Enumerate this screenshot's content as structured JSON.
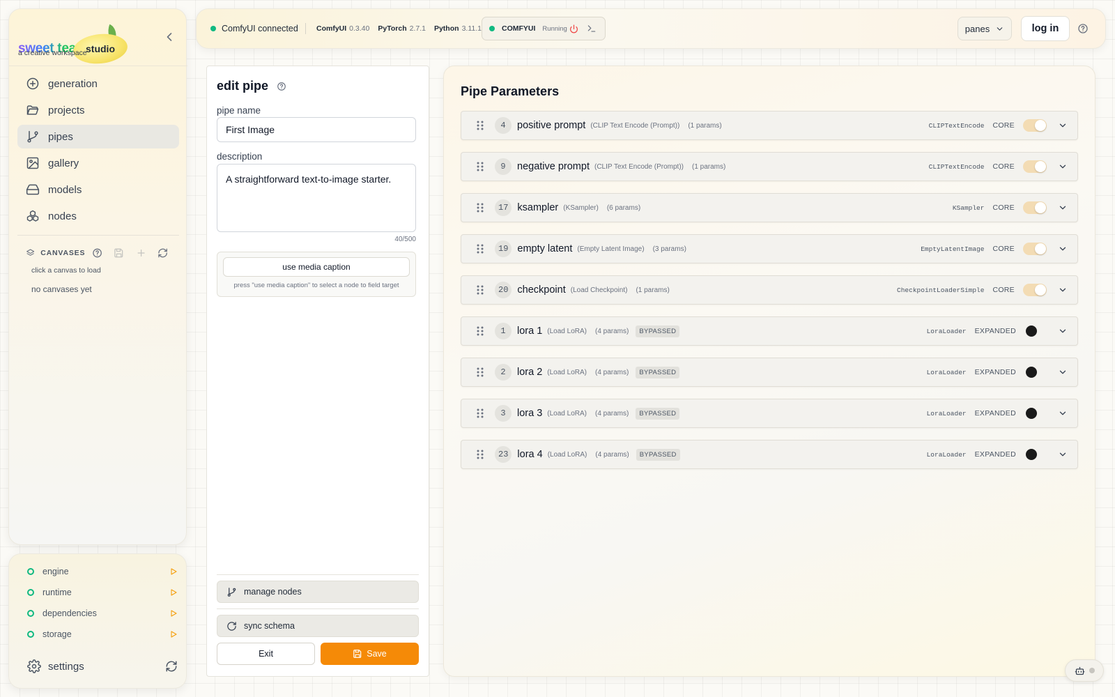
{
  "sidebar": {
    "logo": {
      "sweet": "sweet tea",
      "studio": "studio",
      "tagline": "a creative workspace"
    },
    "nav": [
      {
        "label": "generation",
        "icon": "plus-circle-icon",
        "active": false
      },
      {
        "label": "projects",
        "icon": "folder-icon",
        "active": false
      },
      {
        "label": "pipes",
        "icon": "git-branch-icon",
        "active": true
      },
      {
        "label": "gallery",
        "icon": "image-icon",
        "active": false
      },
      {
        "label": "models",
        "icon": "hard-drive-icon",
        "active": false
      },
      {
        "label": "nodes",
        "icon": "boxes-icon",
        "active": false
      }
    ],
    "canvases": {
      "title": "CANVASES",
      "hint": "click a canvas to load",
      "empty": "no canvases yet"
    }
  },
  "status": {
    "items": [
      {
        "label": "engine",
        "color": "#10b981"
      },
      {
        "label": "runtime",
        "color": "#10b981"
      },
      {
        "label": "dependencies",
        "color": "#10b981"
      },
      {
        "label": "storage",
        "color": "#10b981"
      }
    ],
    "settings_label": "settings"
  },
  "topbar": {
    "connection": "ComfyUI connected",
    "versions": [
      {
        "name": "ComfyUI",
        "version": "0.3.40"
      },
      {
        "name": "PyTorch",
        "version": "2.7.1"
      },
      {
        "name": "Python",
        "version": "3.11.11"
      }
    ],
    "engine": {
      "name": "COMFYUI",
      "state": "Running"
    },
    "panes_label": "panes",
    "login_label": "log in"
  },
  "edit": {
    "title": "edit pipe",
    "name_label": "pipe name",
    "name_value": "First Image",
    "desc_label": "description",
    "desc_value": "A straightforward text-to-image starter.",
    "char_count": "40/500",
    "caption_button": "use media caption",
    "caption_hint": "press \"use media caption\" to select a node to field target",
    "manage_nodes": "manage nodes",
    "sync_schema": "sync schema",
    "exit_label": "Exit",
    "save_label": "Save",
    "accent": "#f58a07"
  },
  "params": {
    "title": "Pipe Parameters",
    "rows": [
      {
        "id": "4",
        "name": "positive prompt",
        "type": "(CLIP Text Encode (Prompt))",
        "params": "(1 params)",
        "bypass": "",
        "cls": "CLIPTextEncode",
        "tag": "CORE",
        "control": "toggle"
      },
      {
        "id": "9",
        "name": "negative prompt",
        "type": "(CLIP Text Encode (Prompt))",
        "params": "(1 params)",
        "bypass": "",
        "cls": "CLIPTextEncode",
        "tag": "CORE",
        "control": "toggle"
      },
      {
        "id": "17",
        "name": "ksampler",
        "type": "(KSampler)",
        "params": "(6 params)",
        "bypass": "",
        "cls": "KSampler",
        "tag": "CORE",
        "control": "toggle"
      },
      {
        "id": "19",
        "name": "empty latent",
        "type": "(Empty Latent Image)",
        "params": "(3 params)",
        "bypass": "",
        "cls": "EmptyLatentImage",
        "tag": "CORE",
        "control": "toggle"
      },
      {
        "id": "20",
        "name": "checkpoint",
        "type": "(Load Checkpoint)",
        "params": "(1 params)",
        "bypass": "",
        "cls": "CheckpointLoaderSimple",
        "tag": "CORE",
        "control": "toggle"
      },
      {
        "id": "1",
        "name": "lora 1",
        "type": "(Load LoRA)",
        "params": "(4 params)",
        "bypass": "BYPASSED",
        "cls": "LoraLoader",
        "tag": "EXPANDED",
        "control": "dot"
      },
      {
        "id": "2",
        "name": "lora 2",
        "type": "(Load LoRA)",
        "params": "(4 params)",
        "bypass": "BYPASSED",
        "cls": "LoraLoader",
        "tag": "EXPANDED",
        "control": "dot"
      },
      {
        "id": "3",
        "name": "lora 3",
        "type": "(Load LoRA)",
        "params": "(4 params)",
        "bypass": "BYPASSED",
        "cls": "LoraLoader",
        "tag": "EXPANDED",
        "control": "dot"
      },
      {
        "id": "23",
        "name": "lora 4",
        "type": "(Load LoRA)",
        "params": "(4 params)",
        "bypass": "BYPASSED",
        "cls": "LoraLoader",
        "tag": "EXPANDED",
        "control": "dot"
      }
    ]
  }
}
